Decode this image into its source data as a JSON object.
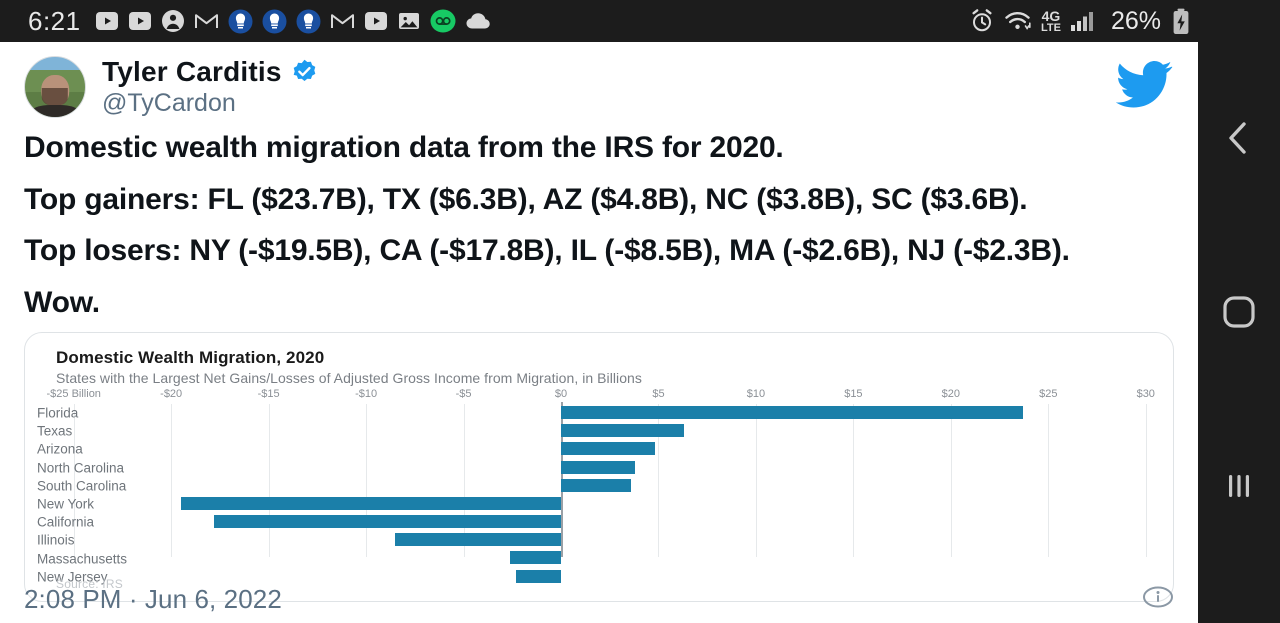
{
  "status_bar": {
    "clock": "6:21",
    "battery_percent": "26%",
    "left_icons": [
      "youtube-icon",
      "youtube-icon",
      "contacts-icon",
      "gmail-icon",
      "app-badge-icon",
      "app-badge-icon",
      "app-badge-icon",
      "gmail-icon",
      "youtube-icon",
      "photos-icon",
      "voicemail-icon",
      "cloud-icon"
    ],
    "right_icons": [
      "alarm-icon",
      "wifi-icon",
      "4g-lte-icon",
      "signal-bars-icon",
      "battery-charging-icon"
    ],
    "network_label": "4G",
    "network_sublabel": "LTE"
  },
  "nav_bar": {
    "back_label": "Back",
    "home_label": "Home",
    "recents_label": "Recent apps"
  },
  "tweet": {
    "display_name": "Tyler Carditis",
    "handle": "@TyCardon",
    "verified": true,
    "logo": "twitter-bird-icon",
    "paragraphs": [
      "Domestic wealth migration data from the IRS for 2020.",
      "Top gainers: FL ($23.7B), TX ($6.3B), AZ ($4.8B), NC ($3.8B), SC ($3.6B).",
      "Top losers: NY (-$19.5B), CA (-$17.8B), IL (-$8.5B), MA (-$2.6B), NJ (-$2.3B).",
      "Wow."
    ],
    "timestamp": "2:08 PM · Jun 6, 2022",
    "info_icon": "info-circle-icon"
  },
  "chart_data": {
    "type": "bar",
    "orientation": "horizontal",
    "title": "Domestic Wealth Migration, 2020",
    "subtitle": "States with the Largest Net Gains/Losses of Adjusted Gross Income from Migration, in Billions",
    "source": "Source: IRS",
    "xlabel": "",
    "ylabel": "",
    "xlim": [
      -27.5,
      31.5
    ],
    "xticks": [
      -25,
      -20,
      -15,
      -10,
      -5,
      0,
      5,
      10,
      15,
      20,
      25,
      30
    ],
    "xtick_labels": [
      "-$25 Billion",
      "-$20",
      "-$15",
      "-$10",
      "-$5",
      "$0",
      "$5",
      "$10",
      "$15",
      "$20",
      "$25",
      "$30"
    ],
    "grid": true,
    "legend": false,
    "bar_color": "#1b7fa9",
    "categories": [
      "Florida",
      "Texas",
      "Arizona",
      "North Carolina",
      "South Carolina",
      "New York",
      "California",
      "Illinois",
      "Massachusetts",
      "New Jersey"
    ],
    "values": [
      23.7,
      6.3,
      4.8,
      3.8,
      3.6,
      -19.5,
      -17.8,
      -8.5,
      -2.6,
      -2.3
    ]
  }
}
